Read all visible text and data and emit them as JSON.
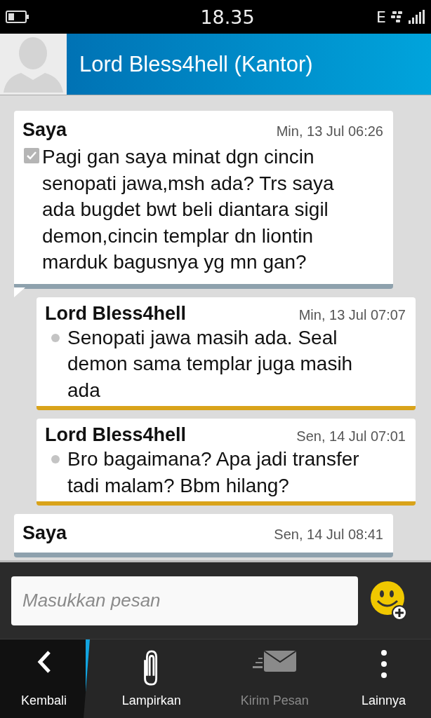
{
  "status_bar": {
    "time": "18.35",
    "network": "E"
  },
  "header": {
    "title": "Lord Bless4hell (Kantor)"
  },
  "messages": [
    {
      "kind": "sent",
      "sender": "Saya",
      "time": "Min, 13 Jul 06:26",
      "body": "Pagi gan saya minat dgn cincin senopati jawa,msh ada? Trs saya ada bugdet bwt beli diantara sigil demon,cincin templar dn liontin marduk bagusnya yg mn gan?"
    },
    {
      "kind": "received",
      "sender": "Lord Bless4hell",
      "time": "Min, 13 Jul 07:07",
      "body": "Senopati jawa masih ada. Seal demon sama templar juga masih ada"
    },
    {
      "kind": "received",
      "sender": "Lord Bless4hell",
      "time": "Sen, 14 Jul 07:01",
      "body": "Bro bagaimana? Apa jadi transfer tadi malam? Bbm hilang?"
    },
    {
      "kind": "sent",
      "sender": "Saya",
      "time": "Sen, 14 Jul 08:41"
    }
  ],
  "compose": {
    "placeholder": "Masukkan pesan"
  },
  "actions": [
    {
      "kind": "back",
      "label": "Kembali",
      "disabled": false
    },
    {
      "kind": "attach",
      "label": "Lampirkan",
      "disabled": false
    },
    {
      "kind": "send",
      "label": "Kirim Pesan",
      "disabled": true
    },
    {
      "kind": "more",
      "label": "Lainnya",
      "disabled": false
    }
  ]
}
